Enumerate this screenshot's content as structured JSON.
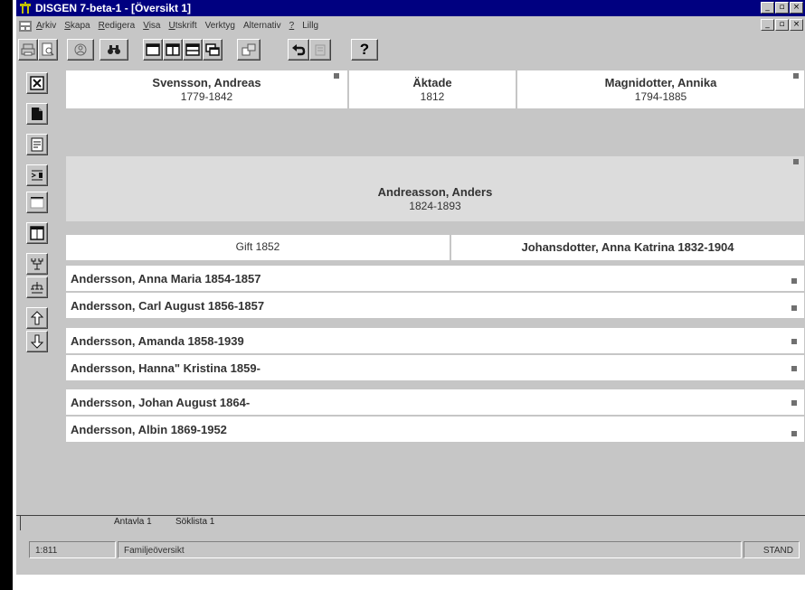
{
  "window": {
    "title": "DISGEN 7-beta-1 - [Översikt 1]",
    "controls": [
      "_",
      "▫",
      "×"
    ]
  },
  "menu": {
    "items": [
      {
        "first": "A",
        "rest": "rkiv"
      },
      {
        "first": "S",
        "rest": "kapa"
      },
      {
        "first": "R",
        "rest": "edigera"
      },
      {
        "first": "V",
        "rest": "isa"
      },
      {
        "first": "U",
        "rest": "tskrift"
      },
      {
        "first": "",
        "rest": "Verktyg"
      },
      {
        "first": "",
        "rest": "Alternativ"
      },
      {
        "first": "?",
        "rest": ""
      },
      {
        "first": "",
        "rest": "Lillg"
      }
    ],
    "mdi_controls": [
      "_",
      "▫",
      "×"
    ]
  },
  "toolbar": {
    "buttons": [
      {
        "icon": "print-icon"
      },
      {
        "icon": "print-preview-icon"
      },
      {
        "icon": "person-icon"
      },
      {
        "icon": "binoculars-icon"
      },
      {
        "icon": "layout-single-icon"
      },
      {
        "icon": "layout-two-columns-icon"
      },
      {
        "icon": "layout-rows-icon"
      },
      {
        "icon": "layout-cascade-icon"
      },
      {
        "icon": "swap-icon"
      },
      {
        "icon": "undo-icon"
      },
      {
        "icon": "redo-icon"
      },
      {
        "icon": "help-icon"
      }
    ],
    "help_label": "?"
  },
  "sidebar": {
    "buttons": [
      {
        "icon": "close-box-icon"
      },
      {
        "icon": "document-icon"
      },
      {
        "icon": "text-page-icon"
      },
      {
        "icon": "columns-swap-icon"
      },
      {
        "icon": "table-view-icon"
      },
      {
        "icon": "window-view-icon"
      },
      {
        "icon": "descendants-tree-icon"
      },
      {
        "icon": "ancestors-tree-icon"
      },
      {
        "icon": "arrow-up-icon"
      },
      {
        "icon": "arrow-down-icon"
      }
    ]
  },
  "family": {
    "father": {
      "name": "Svensson, Andreas",
      "years": "1779-1842"
    },
    "marriage": {
      "label": "Äktade",
      "year": "1812"
    },
    "mother": {
      "name": "Magnidotter, Annika",
      "years": "1794-1885"
    },
    "person": {
      "name": "Andreasson, Anders",
      "years": "1824-1893"
    },
    "spouse_marriage": "Gift 1852",
    "spouse": "Johansdotter, Anna Katrina 1832-1904",
    "children": [
      "Andersson, Anna Maria 1854-1857",
      "Andersson, Carl August 1856-1857",
      "Andersson, Amanda 1858-1939",
      "Andersson, Hanna\" Kristina 1859-",
      "Andersson, Johan August 1864-",
      "Andersson, Albin 1869-1952"
    ]
  },
  "tabs": {
    "items": [
      "Antavla 1",
      "Söklista 1"
    ]
  },
  "statusbar": {
    "position": "1:811",
    "view": "Familjeöversikt",
    "mode": "STAND"
  }
}
